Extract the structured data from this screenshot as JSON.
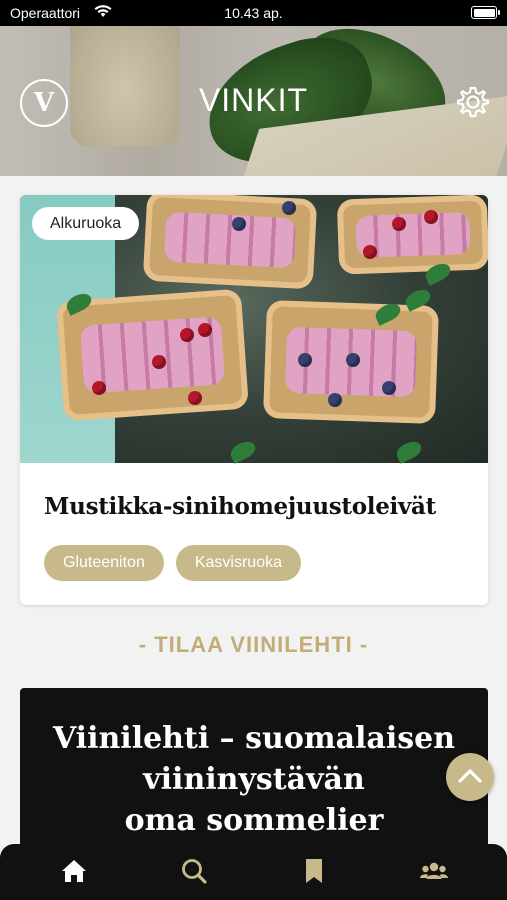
{
  "status_bar": {
    "carrier": "Operaattori",
    "time": "10.43 ap."
  },
  "header": {
    "logo_letter": "V",
    "title": "VINKIT"
  },
  "recipe_card": {
    "category": "Alkuruoka",
    "title": "Mustikka-sinihomejuustoleivät",
    "tags": [
      "Gluteeniton",
      "Kasvisruoka"
    ]
  },
  "subscribe": {
    "heading": "- TILAA VIINILEHTI -"
  },
  "promo": {
    "line1": "Viinilehti – suomalaisen",
    "line2": "viininystävän",
    "line3": "oma sommelier"
  },
  "tab_bar": {
    "active_tab": "home",
    "tabs": [
      "home",
      "search",
      "bookmarks",
      "community"
    ]
  },
  "colors": {
    "accent_gold": "#c8b98a",
    "subscribe_text": "#c2ad78",
    "tab_bar_bg": "#111111",
    "active_tab_icon": "#ffffff"
  }
}
